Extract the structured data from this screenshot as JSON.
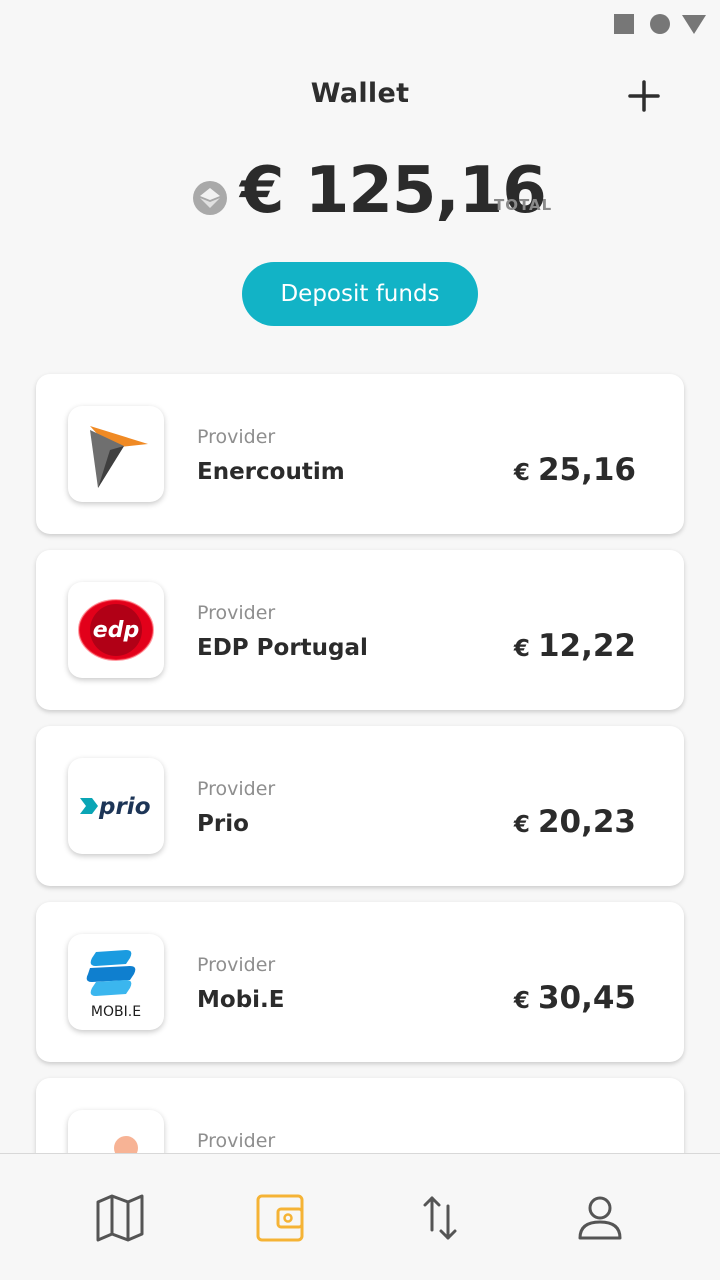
{
  "header": {
    "title": "Wallet"
  },
  "balance": {
    "currency": "€",
    "amount": "125,16",
    "label": "TOTAL"
  },
  "deposit": {
    "label": "Deposit funds"
  },
  "providers": [
    {
      "label": "Provider",
      "name": "Enercoutim",
      "currency": "€",
      "amount": "25,16"
    },
    {
      "label": "Provider",
      "name": "EDP Portugal",
      "currency": "€",
      "amount": "12,22"
    },
    {
      "label": "Provider",
      "name": "Prio",
      "currency": "€",
      "amount": "20,23"
    },
    {
      "label": "Provider",
      "name": "Mobi.E",
      "currency": "€",
      "amount": "30,45"
    },
    {
      "label": "Provider",
      "name": "",
      "currency": "",
      "amount": ""
    }
  ],
  "logos": {
    "edp": "edp",
    "prio": "prio",
    "mobie": "MOBI.E"
  },
  "nav": [
    {
      "icon": "map-icon",
      "active": false
    },
    {
      "icon": "wallet-icon",
      "active": true
    },
    {
      "icon": "transactions-icon",
      "active": false
    },
    {
      "icon": "profile-icon",
      "active": false
    }
  ],
  "colors": {
    "accent": "#12b3c6",
    "active_nav": "#f5b335",
    "icon": "#555555"
  }
}
